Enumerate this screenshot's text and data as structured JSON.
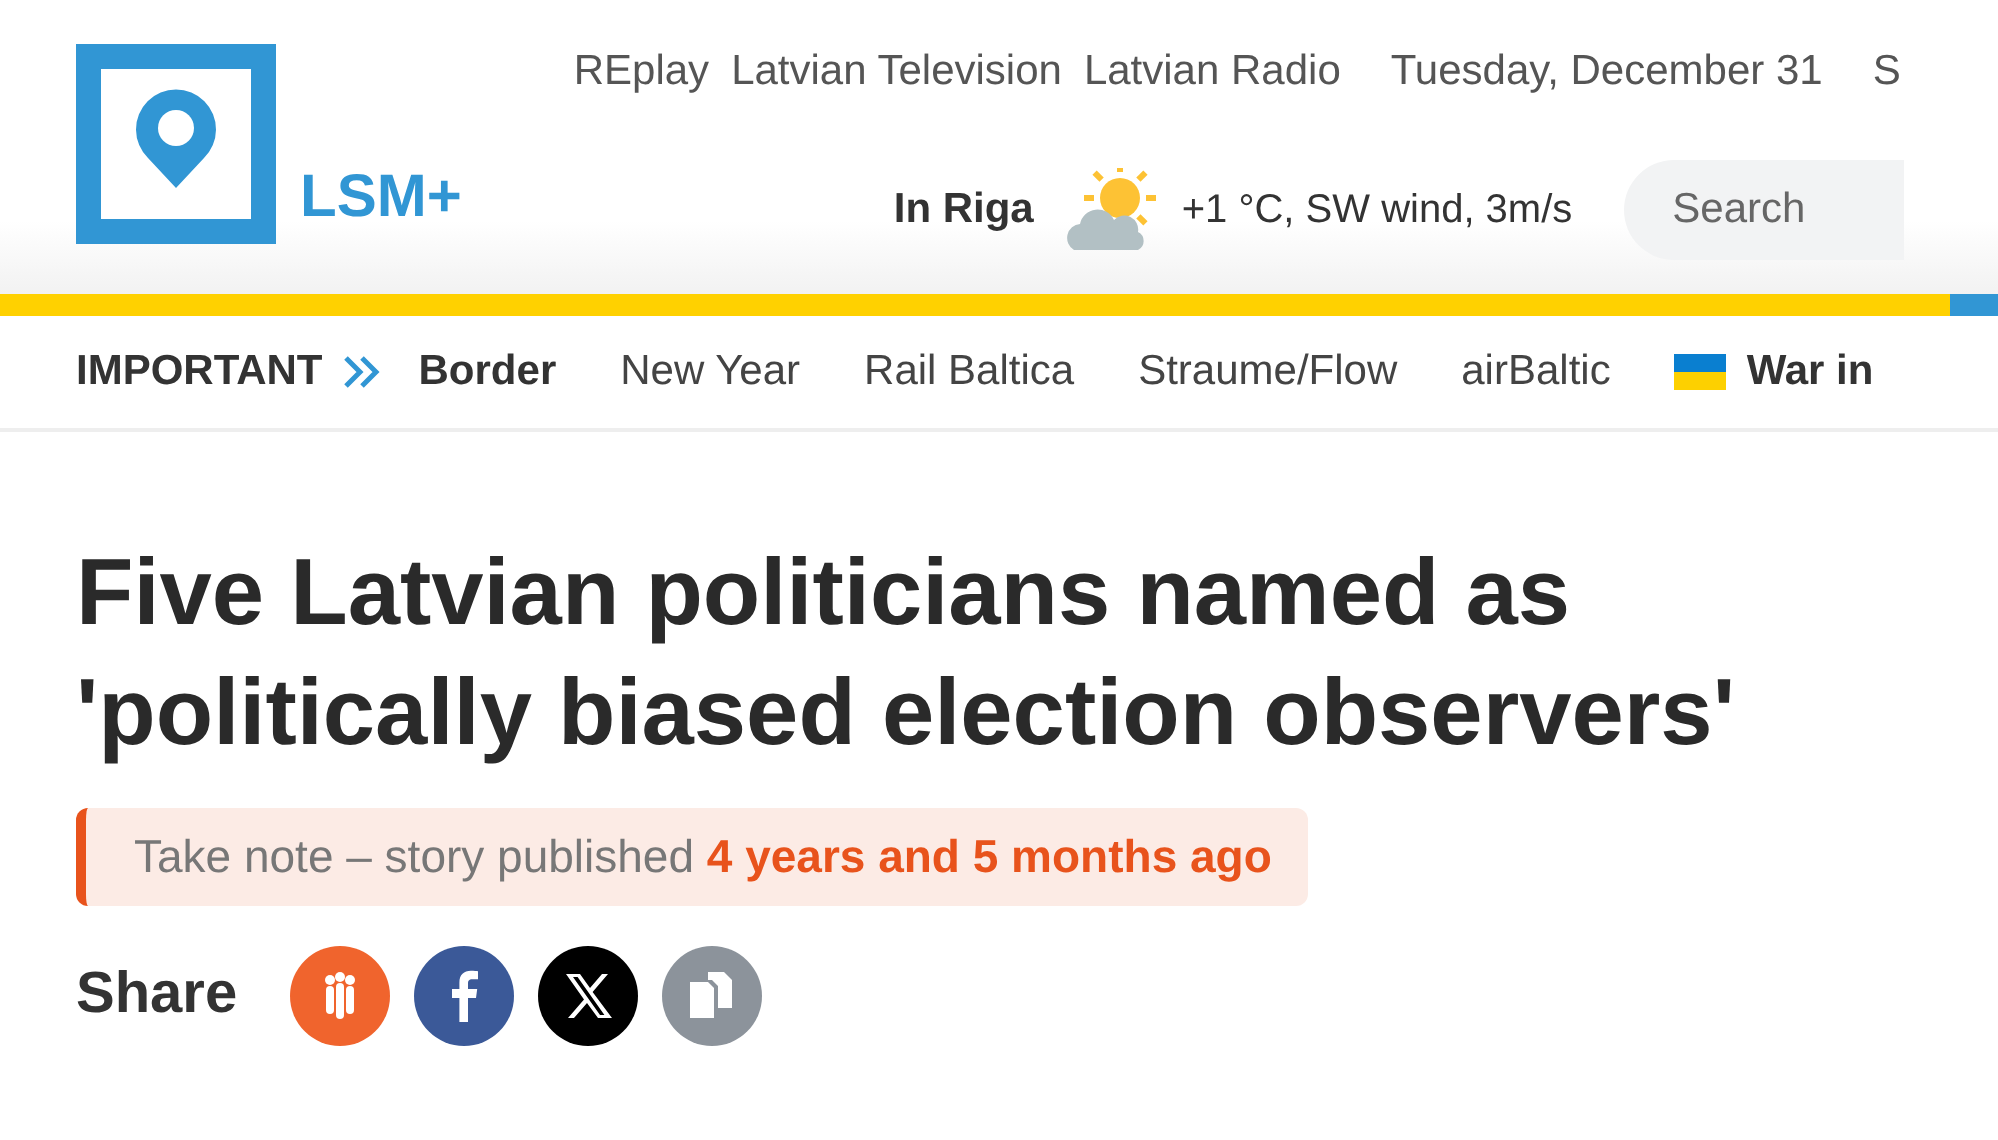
{
  "logo": {
    "text": "LSM+"
  },
  "top_links": [
    "REplay",
    "Latvian Television",
    "Latvian Radio"
  ],
  "date": "Tuesday, December 31",
  "top_cut": "S",
  "weather": {
    "city": "In Riga",
    "reading": "+1 °C, SW wind, 3m/s"
  },
  "search": {
    "placeholder": "Search"
  },
  "important": {
    "label": "IMPORTANT",
    "items": [
      {
        "label": "Border",
        "bold": true,
        "kind": "plain"
      },
      {
        "label": "New Year",
        "bold": false,
        "kind": "plain"
      },
      {
        "label": "Rail Baltica",
        "bold": false,
        "kind": "plain"
      },
      {
        "label": "Straume/Flow",
        "bold": false,
        "kind": "plain"
      },
      {
        "label": "airBaltic",
        "bold": false,
        "kind": "plain"
      },
      {
        "label": "War in",
        "bold": true,
        "kind": "flag"
      }
    ]
  },
  "article": {
    "title": "Five Latvian politicians named as 'politically biased election observers'",
    "notice": "Take note – story published **4 years and 5 months ago**",
    "share_label": "Share",
    "share": [
      {
        "kind": "draugiem",
        "color": "#f0642d"
      },
      {
        "kind": "facebook",
        "color": "#3b5998"
      },
      {
        "kind": "x",
        "color": "#000000"
      },
      {
        "kind": "copy",
        "color": "#8c939b"
      }
    ]
  }
}
